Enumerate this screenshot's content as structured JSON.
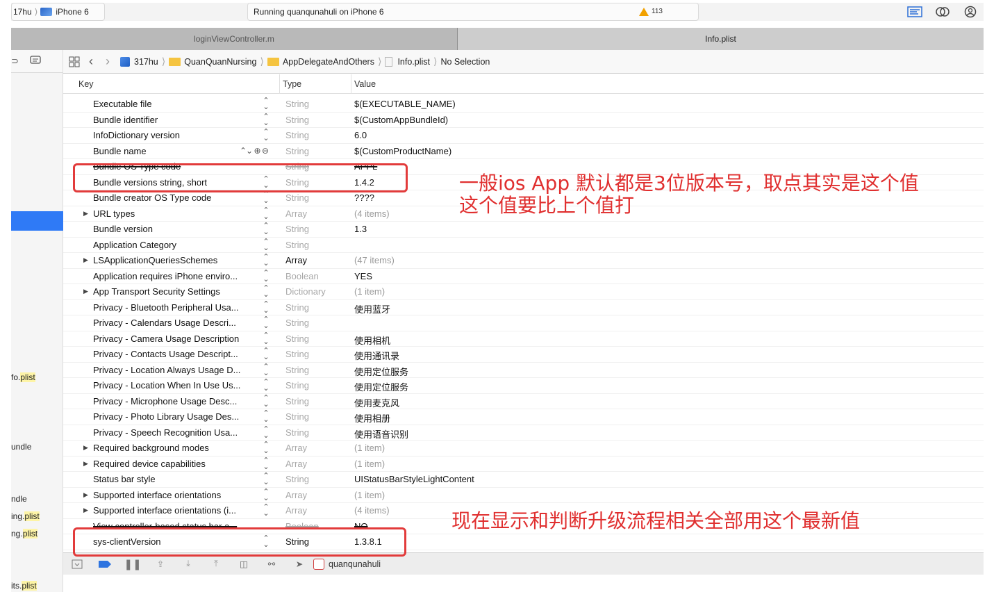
{
  "toolbar": {
    "scheme_project": "17hu",
    "scheme_device": "iPhone 6",
    "activity": "Running quanqunahuli on iPhone 6",
    "warning_count": "113",
    "icons": [
      "standard-editor-icon",
      "assistant-editor-icon",
      "version-editor-icon"
    ]
  },
  "tabs": [
    {
      "label": "loginViewController.m",
      "active": false
    },
    {
      "label": "Info.plist",
      "active": true
    }
  ],
  "navigator": {
    "files": [
      {
        "prefix": "fo.",
        "highlight": "plist"
      },
      {
        "prefix": "undle",
        "highlight": ""
      },
      {
        "prefix": "ndle",
        "highlight": ""
      },
      {
        "prefix": "ing.",
        "highlight": "plist"
      },
      {
        "prefix": "ng.",
        "highlight": "plist"
      },
      {
        "prefix": "its.",
        "highlight": "plist"
      }
    ]
  },
  "jumpbar": {
    "crumbs": [
      "317hu",
      "QuanQuanNursing",
      "AppDelegateAndOthers",
      "Info.plist",
      "No Selection"
    ]
  },
  "table": {
    "headers": {
      "key": "Key",
      "type": "Type",
      "value": "Value"
    },
    "rows": [
      {
        "key": "Executable file",
        "type": "String",
        "value": "$(EXECUTABLE_NAME)"
      },
      {
        "key": "Bundle identifier",
        "type": "String",
        "value": "$(CustomAppBundleId)"
      },
      {
        "key": "InfoDictionary version",
        "type": "String",
        "value": "6.0"
      },
      {
        "key": "Bundle name",
        "type": "String",
        "value": "$(CustomProductName)"
      },
      {
        "key": "Bundle OS Type code",
        "type": "String",
        "value": "APPL"
      },
      {
        "key": "Bundle versions string, short",
        "type": "String",
        "value": "1.4.2"
      },
      {
        "key": "Bundle creator OS Type code",
        "type": "String",
        "value": "????"
      },
      {
        "key": "URL types",
        "type": "Array",
        "value": "(4 items)"
      },
      {
        "key": "Bundle version",
        "type": "String",
        "value": "1.3"
      },
      {
        "key": "Application Category",
        "type": "String",
        "value": ""
      },
      {
        "key": "LSApplicationQueriesSchemes",
        "type": "Array",
        "value": "(47 items)"
      },
      {
        "key": "Application requires iPhone enviro...",
        "type": "Boolean",
        "value": "YES"
      },
      {
        "key": "App Transport Security Settings",
        "type": "Dictionary",
        "value": "(1 item)"
      },
      {
        "key": "Privacy - Bluetooth Peripheral Usa...",
        "type": "String",
        "value": "使用蓝牙"
      },
      {
        "key": "Privacy - Calendars Usage Descri...",
        "type": "String",
        "value": ""
      },
      {
        "key": "Privacy - Camera Usage Description",
        "type": "String",
        "value": "使用相机"
      },
      {
        "key": "Privacy - Contacts Usage Descript...",
        "type": "String",
        "value": "使用通讯录"
      },
      {
        "key": "Privacy - Location Always Usage D...",
        "type": "String",
        "value": "使用定位服务"
      },
      {
        "key": "Privacy - Location When In Use Us...",
        "type": "String",
        "value": "使用定位服务"
      },
      {
        "key": "Privacy - Microphone Usage Desc...",
        "type": "String",
        "value": "使用麦克风"
      },
      {
        "key": "Privacy - Photo Library Usage Des...",
        "type": "String",
        "value": "使用相册"
      },
      {
        "key": "Privacy - Speech Recognition Usa...",
        "type": "String",
        "value": "使用语音识别"
      },
      {
        "key": "Required background modes",
        "type": "Array",
        "value": "(1 item)"
      },
      {
        "key": "Required device capabilities",
        "type": "Array",
        "value": "(1 item)"
      },
      {
        "key": "Status bar style",
        "type": "String",
        "value": "UIStatusBarStyleLightContent"
      },
      {
        "key": "Supported interface orientations",
        "type": "Array",
        "value": "(1 item)"
      },
      {
        "key": "Supported interface orientations (i...",
        "type": "Array",
        "value": "(4 items)"
      },
      {
        "key": "View controller-based status bar a...",
        "type": "Boolean",
        "value": "NO"
      },
      {
        "key": "sys-clientVersion",
        "type": "String",
        "value": "1.3.8.1"
      }
    ]
  },
  "debugbar": {
    "target": "quanqunahuli"
  },
  "annotations": {
    "top_line1": "一般ios App 默认都是3位版本号，取点其实是这个值",
    "top_line2": "这个值要比上个值打",
    "bottom": "现在显示和判断升级流程相关全部用这个最新值",
    "color": "#e02f2f"
  }
}
